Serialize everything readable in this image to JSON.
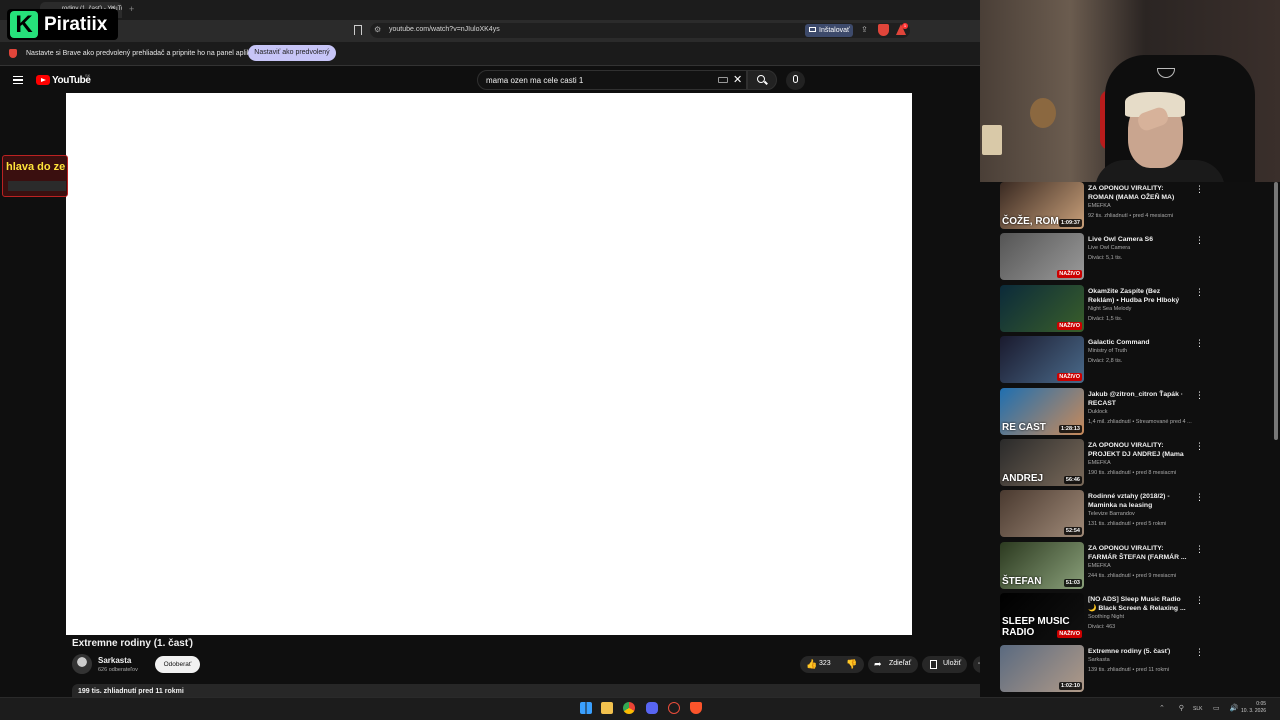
{
  "browser": {
    "tab_title": "rodiny (1. časť) - YouTube",
    "tab_close": "✕",
    "new_tab": "+",
    "url": "youtube.com/watch?v=nJIuloXK4ys",
    "install_label": "Inštalovať",
    "infobar_text": "Nastavte si Brave ako predvolený prehliadač a pripnite ho na panel aplikácií",
    "infobar_button": "Nastaviť ako predvolený",
    "rewards_count": "1"
  },
  "overlay": {
    "logo_letter": "K",
    "logo_text": "Piratiix",
    "side_text": "hlava do ze"
  },
  "youtube": {
    "logo_text": "YouTube",
    "region": "SK",
    "search_value": "mama ozen ma cele casti 1"
  },
  "video": {
    "title": "Extremne rodiny (1. časť)",
    "channel": "Sarkasta",
    "subscribers": "626 odberateľov",
    "subscribe_label": "Odoberať",
    "likes": "323",
    "share_label": "Zdieľať",
    "save_label": "Uložiť",
    "more_label": "⋯",
    "description": "199 tis. zhliadnutí  pred 11 rokmi"
  },
  "recommended": [
    {
      "title": "ZA OPONOU VIRALITY: ROMAN (MAMA OŽEŇ MA)",
      "channel": "EMEFKA",
      "meta": "92 tis. zhliadnutí • pred 4 mesiacmi",
      "badge": "1:09:37",
      "live": false,
      "thumb_text": "ČOŽE, ROM",
      "color1": "#3a2a22",
      "color2": "#c9a07a"
    },
    {
      "title": "Live Owl Camera S6",
      "channel": "Live Owl Camera",
      "meta": "Diváci: 5,1 tis.",
      "badge": "NAŽIVO",
      "live": true,
      "thumb_text": "",
      "color1": "#555555",
      "color2": "#9a9a9a"
    },
    {
      "title": "Okamžite Zaspíte (Bez Reklám) • Hudba Pre Hlboký Spánok • ...",
      "channel": "Night Sea Melody",
      "meta": "Diváci: 1,5 tis.",
      "badge": "NAŽIVO",
      "live": true,
      "thumb_text": "",
      "color1": "#0b2a3a",
      "color2": "#3a5f2a"
    },
    {
      "title": "Galactic Command",
      "channel": "Ministry of Truth",
      "meta": "Diváci: 2,8 tis.",
      "badge": "NAŽIVO",
      "live": true,
      "thumb_text": "",
      "color1": "#1a1a2e",
      "color2": "#4a6a8a"
    },
    {
      "title": "Jakub @zitron_citron  Ťapák · RECAST",
      "channel": "Duklock",
      "meta": "1,4 mil. zhliadnutí • Streamované pred 4 ...",
      "badge": "1:28:13",
      "live": false,
      "thumb_text": "RE CAST",
      "color1": "#1f6fb0",
      "color2": "#c98a5a"
    },
    {
      "title": "ZA OPONOU VIRALITY: PROJEKT DJ ANDREJ (Mama ...",
      "channel": "EMEFKA",
      "meta": "190 tis. zhliadnutí • pred 8 mesiacmi",
      "badge": "56:46",
      "live": false,
      "thumb_text": "ANDREJ",
      "color1": "#2a2a2a",
      "color2": "#7a6a5a"
    },
    {
      "title": "Rodinné vztahy (2018/2) - Maminka na leasing",
      "channel": "Televize Barrandov",
      "meta": "131 tis. zhliadnutí • pred 5 rokmi",
      "badge": "52:54",
      "live": false,
      "thumb_text": "",
      "color1": "#4a3a30",
      "color2": "#a08a78"
    },
    {
      "title": "ZA OPONOU VIRALITY: FARMÁR ŠTEFAN (FARMÁR ...",
      "channel": "EMEFKA",
      "meta": "244 tis. zhliadnutí • pred 9 mesiacmi",
      "badge": "51:03",
      "live": false,
      "thumb_text": "ŠTEFAN",
      "color1": "#2c3a20",
      "color2": "#8aa07a"
    },
    {
      "title": "[NO ADS] Sleep Music Radio 🌙 Black Screen & Relaxing ...",
      "channel": "Soothing Night",
      "meta": "Diváci: 463",
      "badge": "NAŽIVO",
      "live": true,
      "thumb_text": "SLEEP MUSIC RADIO",
      "color1": "#000000",
      "color2": "#111111"
    },
    {
      "title": "Extremne rodiny (5. časť)",
      "channel": "Sarkasta",
      "meta": "139 tis. zhliadnutí • pred 11 rokmi",
      "badge": "1:02:10",
      "live": false,
      "thumb_text": "",
      "color1": "#5a6a80",
      "color2": "#b09a88"
    }
  ],
  "rec_menu": "⋮",
  "taskbar": {
    "lang": "SLK",
    "time": "0:05",
    "date": "10. 3. 2026"
  }
}
